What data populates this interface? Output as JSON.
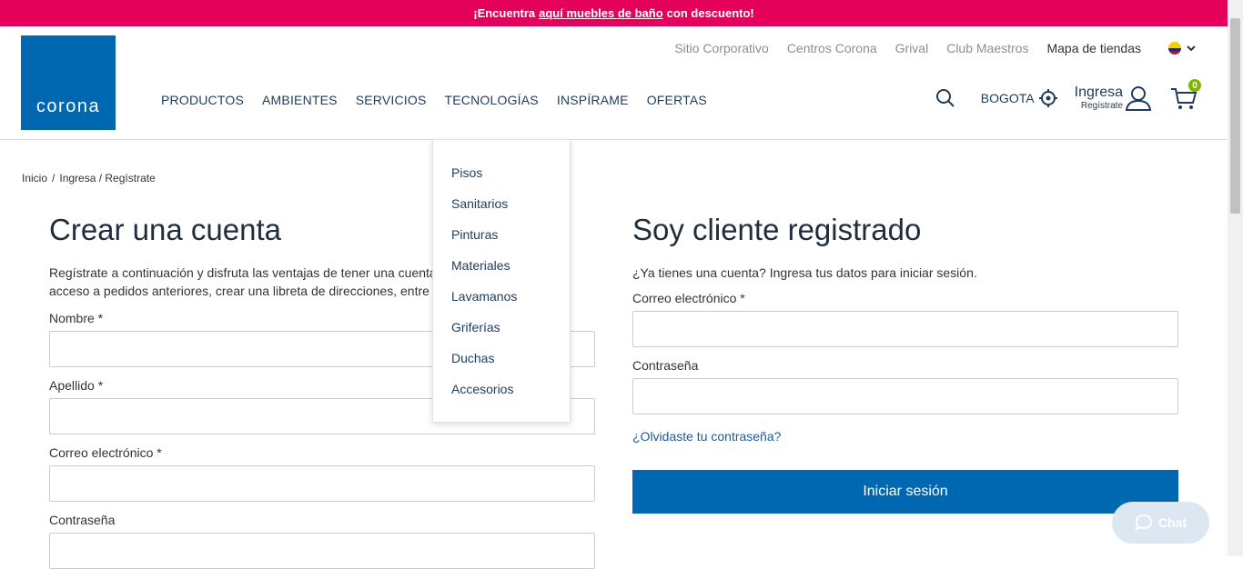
{
  "promo": {
    "prefix": "¡Encuentra",
    "link": "aquí muebles de baño",
    "suffix": "con descuento!"
  },
  "brand": {
    "logo_text": "corona",
    "color": "#0067b1"
  },
  "top_links": [
    "Sitio Corporativo",
    "Centros Corona",
    "Grival",
    "Club Maestros",
    "Mapa de tiendas"
  ],
  "main_nav": [
    "PRODUCTOS",
    "AMBIENTES",
    "SERVICIOS",
    "TECNOLOGÍAS",
    "INSPÍRAME",
    "OFERTAS"
  ],
  "tools": {
    "city": "BOGOTA",
    "login_main": "Ingresa",
    "login_sub": "Regístrate",
    "cart_count": "0"
  },
  "breadcrumb": [
    "Inicio",
    "Ingresa / Regístrate"
  ],
  "create_account": {
    "title": "Crear una cuenta",
    "intro": "Regístrate a continuación y disfruta las ventajas de tener una cuenta: compra más rápido, acceso a pedidos anteriores, crear una libreta de direcciones, entre otras cosas.",
    "fields": [
      "Nombre *",
      "Apellido *",
      "Correo electrónico *",
      "Contraseña"
    ]
  },
  "login": {
    "title": "Soy cliente registrado",
    "intro": "¿Ya tienes una cuenta? Ingresa tus datos para iniciar sesión.",
    "email_label": "Correo electrónico *",
    "password_label": "Contraseña",
    "forgot": "¿Olvidaste tu contraseña?",
    "submit": "Iniciar sesión"
  },
  "dropdown": [
    "Pisos",
    "Sanitarios",
    "Pinturas",
    "Materiales",
    "Lavamanos",
    "Griferías",
    "Duchas",
    "Accesorios"
  ],
  "chat": {
    "label": "Chat"
  },
  "colors": {
    "promo_bg": "#e5005a",
    "primary": "#0067b1",
    "cart_badge": "#7ab800"
  }
}
